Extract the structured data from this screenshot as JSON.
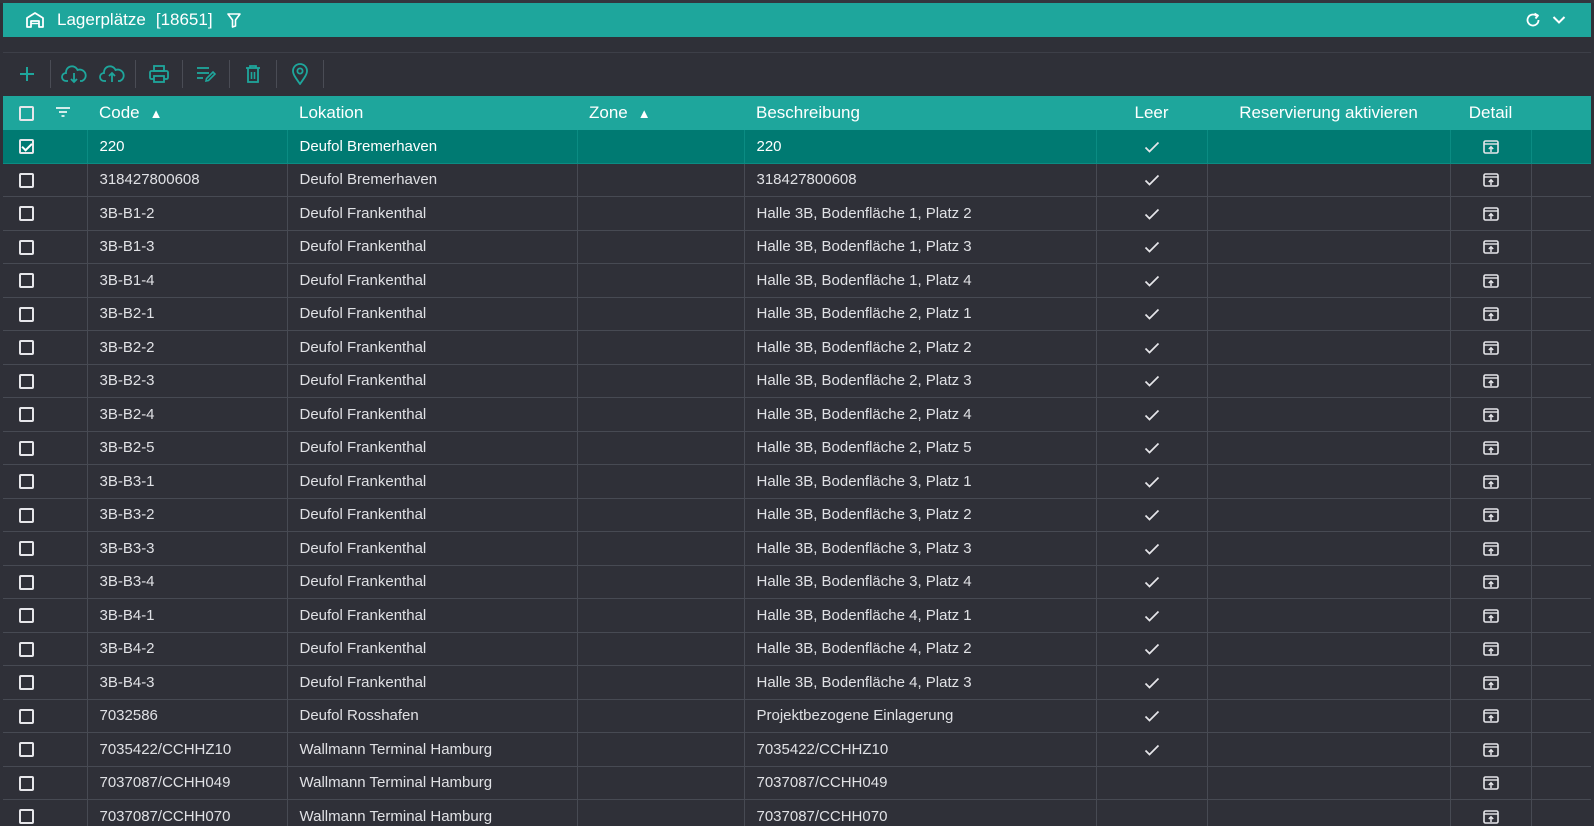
{
  "header": {
    "title": "Lagerplätze",
    "count": "[18651]",
    "icons": {
      "home": "warehouse-icon",
      "filter": "filter-icon",
      "refresh": "refresh-icon",
      "collapse": "chevron-down-icon"
    }
  },
  "toolbar": {
    "buttons": [
      "add-icon",
      "cloud-download-icon",
      "cloud-upload-icon",
      "print-icon",
      "edit-list-icon",
      "delete-icon",
      "location-pin-icon"
    ]
  },
  "colors": {
    "accent": "#1ea69c",
    "selected_row": "#007a72",
    "background": "#2f3038"
  },
  "table": {
    "columns": {
      "code": "Code",
      "lokation": "Lokation",
      "zone": "Zone",
      "beschreibung": "Beschreibung",
      "leer": "Leer",
      "reservierung": "Reservierung aktivieren",
      "detail": "Detail"
    },
    "sort_indicator": "▲",
    "rows": [
      {
        "code": "220",
        "lokation": "Deufol Bremerhaven",
        "zone": "",
        "beschreibung": "220",
        "leer": true,
        "selected": true
      },
      {
        "code": "318427800608",
        "lokation": "Deufol Bremerhaven",
        "zone": "",
        "beschreibung": "318427800608",
        "leer": true,
        "selected": false
      },
      {
        "code": "3B-B1-2",
        "lokation": "Deufol Frankenthal",
        "zone": "",
        "beschreibung": "Halle 3B, Bodenfläche 1, Platz 2",
        "leer": true,
        "selected": false
      },
      {
        "code": "3B-B1-3",
        "lokation": "Deufol Frankenthal",
        "zone": "",
        "beschreibung": "Halle 3B, Bodenfläche 1, Platz 3",
        "leer": true,
        "selected": false
      },
      {
        "code": "3B-B1-4",
        "lokation": "Deufol Frankenthal",
        "zone": "",
        "beschreibung": "Halle 3B, Bodenfläche 1, Platz 4",
        "leer": true,
        "selected": false
      },
      {
        "code": "3B-B2-1",
        "lokation": "Deufol Frankenthal",
        "zone": "",
        "beschreibung": "Halle 3B, Bodenfläche 2, Platz 1",
        "leer": true,
        "selected": false
      },
      {
        "code": "3B-B2-2",
        "lokation": "Deufol Frankenthal",
        "zone": "",
        "beschreibung": "Halle 3B, Bodenfläche 2, Platz 2",
        "leer": true,
        "selected": false
      },
      {
        "code": "3B-B2-3",
        "lokation": "Deufol Frankenthal",
        "zone": "",
        "beschreibung": "Halle 3B, Bodenfläche 2, Platz 3",
        "leer": true,
        "selected": false
      },
      {
        "code": "3B-B2-4",
        "lokation": "Deufol Frankenthal",
        "zone": "",
        "beschreibung": "Halle 3B, Bodenfläche 2, Platz 4",
        "leer": true,
        "selected": false
      },
      {
        "code": "3B-B2-5",
        "lokation": "Deufol Frankenthal",
        "zone": "",
        "beschreibung": "Halle 3B, Bodenfläche 2, Platz 5",
        "leer": true,
        "selected": false
      },
      {
        "code": "3B-B3-1",
        "lokation": "Deufol Frankenthal",
        "zone": "",
        "beschreibung": "Halle 3B, Bodenfläche 3, Platz 1",
        "leer": true,
        "selected": false
      },
      {
        "code": "3B-B3-2",
        "lokation": "Deufol Frankenthal",
        "zone": "",
        "beschreibung": "Halle 3B, Bodenfläche 3, Platz 2",
        "leer": true,
        "selected": false
      },
      {
        "code": "3B-B3-3",
        "lokation": "Deufol Frankenthal",
        "zone": "",
        "beschreibung": "Halle 3B, Bodenfläche 3, Platz 3",
        "leer": true,
        "selected": false
      },
      {
        "code": "3B-B3-4",
        "lokation": "Deufol Frankenthal",
        "zone": "",
        "beschreibung": "Halle 3B, Bodenfläche 3, Platz 4",
        "leer": true,
        "selected": false
      },
      {
        "code": "3B-B4-1",
        "lokation": "Deufol Frankenthal",
        "zone": "",
        "beschreibung": "Halle 3B, Bodenfläche 4, Platz 1",
        "leer": true,
        "selected": false
      },
      {
        "code": "3B-B4-2",
        "lokation": "Deufol Frankenthal",
        "zone": "",
        "beschreibung": "Halle 3B, Bodenfläche 4, Platz 2",
        "leer": true,
        "selected": false
      },
      {
        "code": "3B-B4-3",
        "lokation": "Deufol Frankenthal",
        "zone": "",
        "beschreibung": "Halle 3B, Bodenfläche 4, Platz 3",
        "leer": true,
        "selected": false
      },
      {
        "code": "7032586",
        "lokation": "Deufol Rosshafen",
        "zone": "",
        "beschreibung": "Projektbezogene Einlagerung",
        "leer": true,
        "selected": false
      },
      {
        "code": "7035422/CCHHZ10",
        "lokation": "Wallmann Terminal Hamburg",
        "zone": "",
        "beschreibung": "7035422/CCHHZ10",
        "leer": true,
        "selected": false
      },
      {
        "code": "7037087/CCHH049",
        "lokation": "Wallmann Terminal Hamburg",
        "zone": "",
        "beschreibung": "7037087/CCHH049",
        "leer": false,
        "selected": false
      },
      {
        "code": "7037087/CCHH070",
        "lokation": "Wallmann Terminal Hamburg",
        "zone": "",
        "beschreibung": "7037087/CCHH070",
        "leer": false,
        "selected": false
      }
    ]
  }
}
